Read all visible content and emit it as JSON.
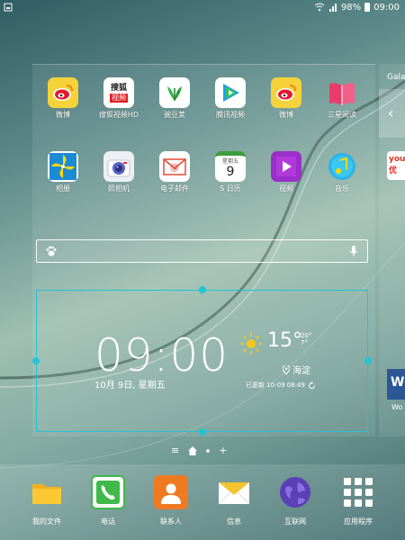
{
  "status_bar": {
    "battery_percent": "98%",
    "time": "09:00"
  },
  "next_page": {
    "title": "Galaxy",
    "app_partial": "you 优",
    "word_label": "W",
    "word_caption": "Wo"
  },
  "apps_row1": [
    {
      "label": "微博",
      "icon": "weibo-icon"
    },
    {
      "label": "搜狐视频HD",
      "icon": "sohu-video-icon",
      "icon_text": "搜狐视频"
    },
    {
      "label": "豌豆荚",
      "icon": "wandoujia-icon"
    },
    {
      "label": "腾讯视频",
      "icon": "tencent-video-icon"
    },
    {
      "label": "微博",
      "icon": "weibo-icon"
    },
    {
      "label": "三星阅读",
      "icon": "samsung-books-icon"
    }
  ],
  "apps_row2": [
    {
      "label": "相册",
      "icon": "gallery-icon"
    },
    {
      "label": "照相机",
      "icon": "camera-icon"
    },
    {
      "label": "电子邮件",
      "icon": "email-icon"
    },
    {
      "label": "S 日历",
      "icon": "calendar-icon",
      "icon_day": "9",
      "icon_week": "星期五"
    },
    {
      "label": "视频",
      "icon": "video-icon"
    },
    {
      "label": "音乐",
      "icon": "music-icon"
    }
  ],
  "search": {
    "placeholder": ""
  },
  "clock_widget": {
    "time": "09:00",
    "date": "10月 9日, 星期五",
    "temperature": "15°",
    "temp_high": "20°",
    "temp_low": "7°",
    "location": "海淀",
    "updated": "已更新  10-09 08:49"
  },
  "page_indicator": {
    "menu": "≡",
    "add": "+"
  },
  "dock": [
    {
      "label": "我的文件",
      "icon": "folder-icon",
      "color": "#f6b21b"
    },
    {
      "label": "电话",
      "icon": "phone-icon",
      "color": "#3fb94a"
    },
    {
      "label": "联系人",
      "icon": "contacts-icon",
      "color": "#f07a22"
    },
    {
      "label": "信息",
      "icon": "messages-icon",
      "color": "#f4c531"
    },
    {
      "label": "互联网",
      "icon": "internet-icon",
      "color": "#5b3fb6"
    },
    {
      "label": "应用程序",
      "icon": "apps-grid-icon",
      "color": "#ffffff"
    }
  ],
  "colors": {
    "selection": "#23c4d2",
    "accent_sun": "#f6c81b"
  }
}
